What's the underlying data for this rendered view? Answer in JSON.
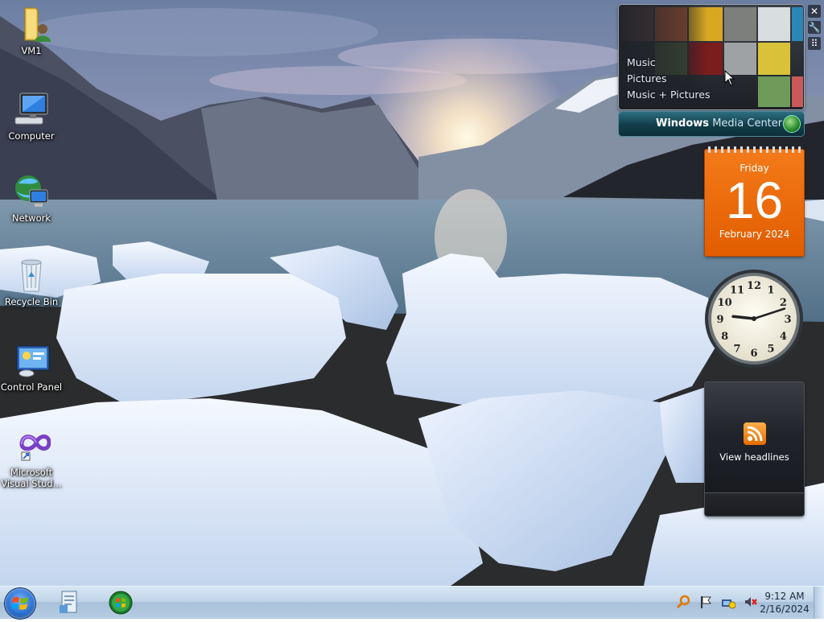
{
  "desktop": {
    "icons": [
      {
        "label": "VM1",
        "icon": "user-folder-icon"
      },
      {
        "label": "Computer",
        "icon": "computer-icon"
      },
      {
        "label": "Network",
        "icon": "network-icon"
      },
      {
        "label": "Recycle Bin",
        "icon": "recycle-bin-icon"
      },
      {
        "label": "Control Panel",
        "icon": "control-panel-icon"
      },
      {
        "label": "Microsoft Visual Stud...",
        "icon": "visual-studio-icon"
      }
    ]
  },
  "media_center": {
    "menu": [
      "Music",
      "Pictures",
      "Music + Pictures"
    ],
    "brand_bold": "Windows",
    "brand_light": "Media Center"
  },
  "calendar": {
    "weekday": "Friday",
    "day": "16",
    "month_year": "February 2024"
  },
  "analog_clock": {
    "numerals": [
      "12",
      "1",
      "2",
      "3",
      "4",
      "5",
      "6",
      "7",
      "8",
      "9",
      "10",
      "11"
    ],
    "hour": 9,
    "minute": 12
  },
  "feed_headlines": {
    "label": "View headlines"
  },
  "taskbar": {
    "time": "9:12 AM",
    "date": "2/16/2024"
  },
  "colors": {
    "calendar_orange": "#e8680a",
    "taskbar_blue": "#b7cde3",
    "media_center_teal": "#123d4a"
  }
}
